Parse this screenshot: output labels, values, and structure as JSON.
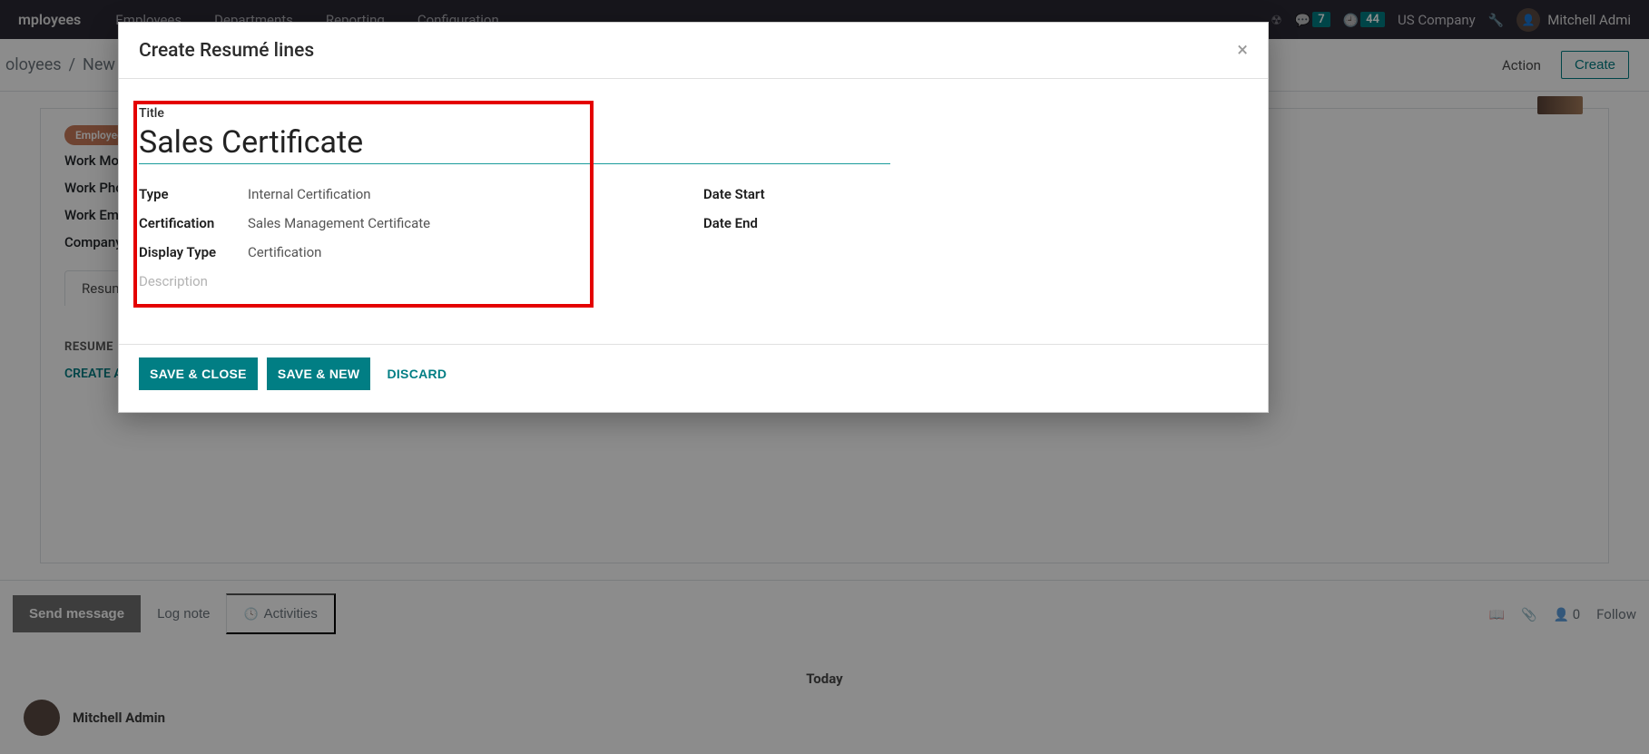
{
  "navbar": {
    "app": "mployees",
    "menu": [
      "Employees",
      "Departments",
      "Reporting",
      "Configuration"
    ],
    "chat_badge": "7",
    "clock_badge": "44",
    "company": "US Company",
    "user": "Mitchell Admi"
  },
  "subheader": {
    "bc_root": "oloyees",
    "bc_sep": "/",
    "bc_current": "New",
    "action": "Action",
    "create": "Create"
  },
  "bgform": {
    "tag": "Employee",
    "labels": {
      "work_mo": "Work Mo",
      "work_pho": "Work Pho",
      "work_ema": "Work Ema",
      "company": "Company"
    },
    "tab": "Resume",
    "section": "RESUME",
    "create_link": "CREATE A"
  },
  "chatter": {
    "send": "Send message",
    "lognote": "Log note",
    "activities": "Activities",
    "followers": "0",
    "follow": "Follow",
    "today": "Today",
    "entry_name": "Mitchell Admin"
  },
  "modal": {
    "title": "Create Resumé lines",
    "fields": {
      "title_label": "Title",
      "title_value": "Sales Certificate",
      "type_label": "Type",
      "type_value": "Internal Certification",
      "cert_label": "Certification",
      "cert_value": "Sales Management Certificate",
      "display_label": "Display Type",
      "display_value": "Certification",
      "date_start_label": "Date Start",
      "date_end_label": "Date End",
      "desc_placeholder": "Description"
    },
    "buttons": {
      "save_close": "SAVE & CLOSE",
      "save_new": "SAVE & NEW",
      "discard": "DISCARD"
    }
  }
}
